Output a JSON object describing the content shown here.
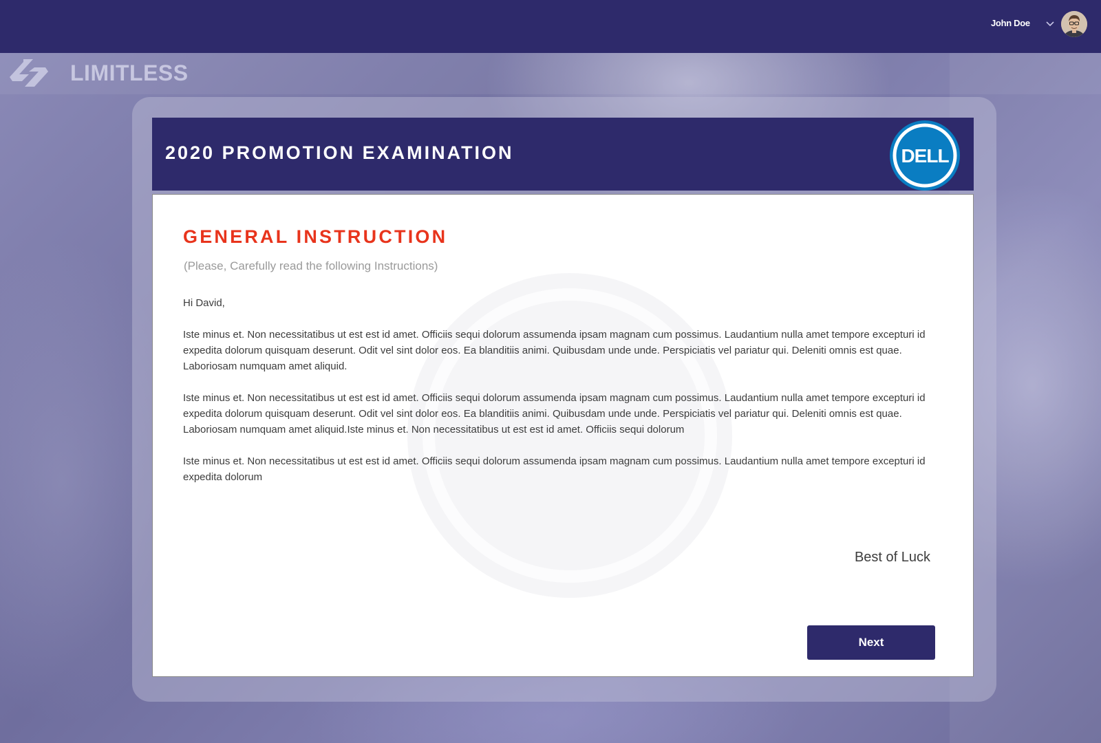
{
  "header": {
    "user_name": "John Doe"
  },
  "brand": {
    "name": "LIMITLESS"
  },
  "exam": {
    "title": "2020 PROMOTION EXAMINATION",
    "logo_text": "DELL"
  },
  "instructions": {
    "heading": "GENERAL INSTRUCTION",
    "subheading": "(Please, Carefully read the following Instructions)",
    "greeting": "Hi David,",
    "paragraphs": [
      "Iste minus et. Non necessitatibus ut est est id amet. Officiis sequi dolorum assumenda ipsam magnam cum possimus. Laudantium nulla amet tempore excepturi id expedita dolorum quisquam deserunt. Odit vel sint dolor eos. Ea blanditiis animi. Quibusdam unde unde. Perspiciatis vel pariatur qui. Deleniti omnis est quae. Laboriosam numquam amet aliquid.",
      "Iste minus et. Non necessitatibus ut est est id amet. Officiis sequi dolorum assumenda ipsam magnam cum possimus. Laudantium nulla amet tempore excepturi id expedita dolorum quisquam deserunt. Odit vel sint dolor eos. Ea blanditiis animi. Quibusdam unde unde. Perspiciatis vel pariatur qui. Deleniti omnis est quae. Laboriosam numquam amet aliquid.Iste minus et. Non necessitatibus ut est est id amet. Officiis sequi dolorum",
      "Iste minus et. Non necessitatibus ut est est id amet. Officiis sequi dolorum assumenda ipsam magnam cum possimus. Laudantium nulla amet tempore excepturi id expedita dolorum"
    ],
    "signoff": "Best of Luck"
  },
  "actions": {
    "next_label": "Next"
  },
  "colors": {
    "navy": "#2e2a6b",
    "accent_red": "#e8341c",
    "dell_blue": "#0a7dc2"
  },
  "icons": {
    "user_menu": "chevron-down-icon",
    "avatar": "user-avatar",
    "brand": "limitless-logo-icon"
  }
}
